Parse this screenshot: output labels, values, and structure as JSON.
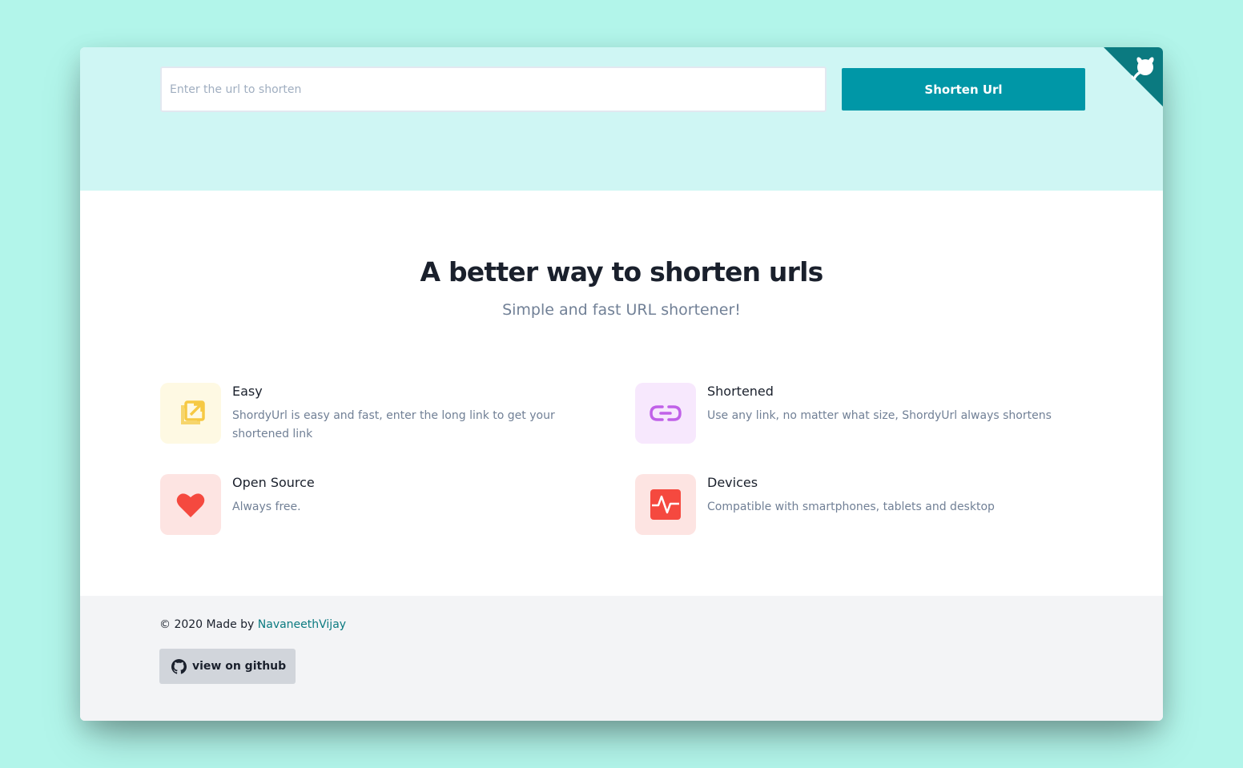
{
  "colors": {
    "page_bg": "#b2f5ea",
    "header_bg": "#cff6f4",
    "accent": "#0097a7",
    "footer_bg": "#f3f4f6",
    "link": "#0b7a80"
  },
  "header": {
    "url_placeholder": "Enter the url to shorten",
    "url_value": "",
    "shorten_label": "Shorten Url",
    "corner_icon": "github-octocat-icon"
  },
  "hero": {
    "title": "A better way to shorten urls",
    "subtitle": "Simple and fast URL shortener!"
  },
  "features": [
    {
      "title": "Easy",
      "desc": "ShordyUrl is easy and fast, enter the long link to get your shortened link",
      "icon": "external-link-icon",
      "color": "#f6c944",
      "bg": "#fef9e3"
    },
    {
      "title": "Shortened",
      "desc": "Use any link, no matter what size, ShordyUrl always shortens",
      "icon": "link-icon",
      "color": "#c061e8",
      "bg": "#f7e8fd"
    },
    {
      "title": "Open Source",
      "desc": "Always free.",
      "icon": "heart-icon",
      "color": "#f5493f",
      "bg": "#fde4e2"
    },
    {
      "title": "Devices",
      "desc": "Compatible with smartphones, tablets and desktop",
      "icon": "activity-icon",
      "color": "#f5493f",
      "bg": "#fde4e2"
    }
  ],
  "footer": {
    "copyright": "© 2020 Made by",
    "author": "NavaneethVijay",
    "github_label": "view on github"
  }
}
